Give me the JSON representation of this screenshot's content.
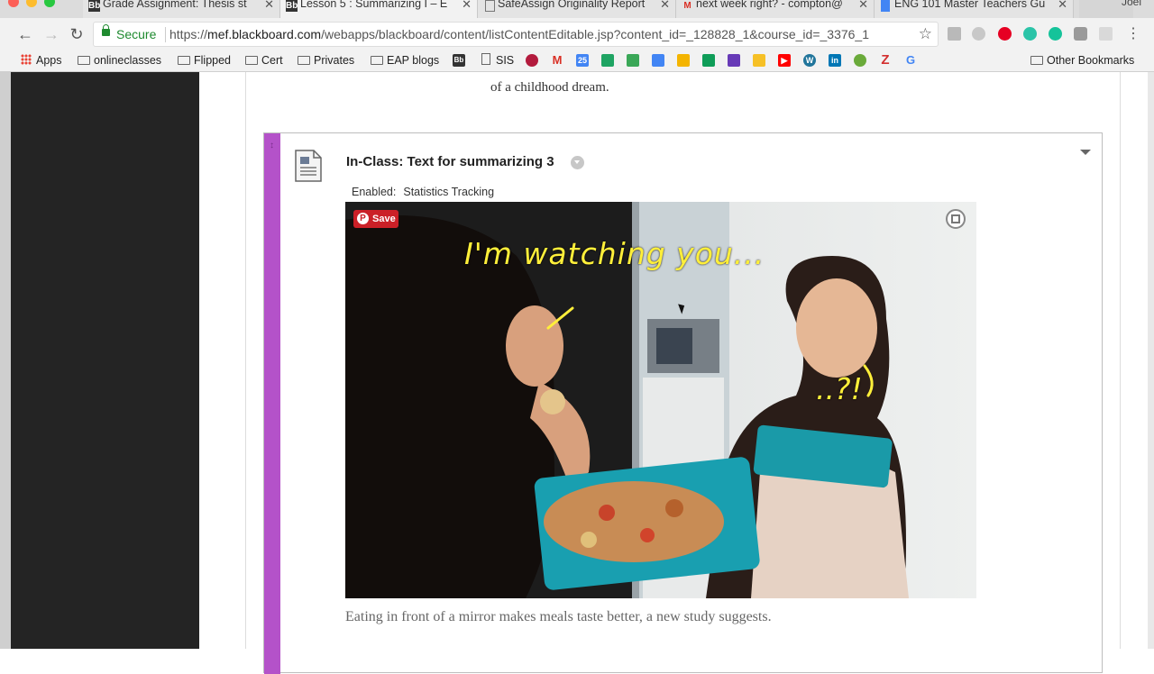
{
  "browser": {
    "tabs": [
      {
        "title": "Grade Assignment: Thesis st",
        "icon": "blackboard-icon",
        "active": false
      },
      {
        "title": "Lesson 5 : Summarizing I – E",
        "icon": "blackboard-icon",
        "active": true
      },
      {
        "title": "SafeAssign Originality Report",
        "icon": "document-icon",
        "active": false
      },
      {
        "title": "next week right? - compton@",
        "icon": "gmail-icon",
        "active": false
      },
      {
        "title": "ENG 101 Master Teachers Gu",
        "icon": "google-docs-icon",
        "active": false
      }
    ],
    "profile_name": "Joel",
    "secure_label": "Secure",
    "url_scheme": "https://",
    "url_host": "mef.blackboard.com",
    "url_path": "/webapps/blackboard/content/listContentEditable.jsp?content_id=_128828_1&course_id=_3376_1",
    "bookmarks": [
      {
        "label": "Apps",
        "icon": "apps-grid-icon"
      },
      {
        "label": "onlineclasses",
        "icon": "folder-icon"
      },
      {
        "label": "Flipped",
        "icon": "folder-icon"
      },
      {
        "label": "Cert",
        "icon": "folder-icon"
      },
      {
        "label": "Privates",
        "icon": "folder-icon"
      },
      {
        "label": "EAP blogs",
        "icon": "folder-icon"
      },
      {
        "label": "SIS",
        "icon": "document-icon"
      }
    ],
    "other_bookmarks": "Other Bookmarks"
  },
  "content": {
    "prev_item_tail": "of a childhood dream.",
    "item": {
      "title": "In-Class: Text for summarizing 3",
      "enabled_label": "Enabled:",
      "enabled_value": "Statistics Tracking",
      "image": {
        "pin_save_label": "Save",
        "overlay_text": "I'm watching you...",
        "overlay_text_2": "..?!"
      },
      "caption": "Eating in front of a mirror makes meals taste better, a new study suggests."
    }
  },
  "colors": {
    "item_accent": "#b452c9",
    "secure_green": "#1e8a2f",
    "pinterest_red": "#cb2027"
  }
}
